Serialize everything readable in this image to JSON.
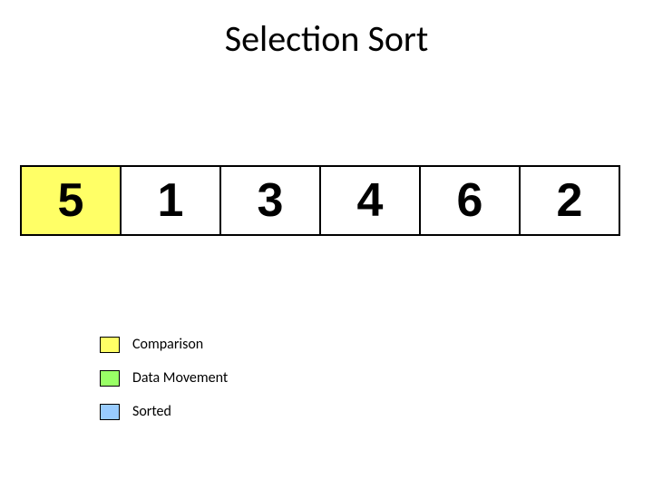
{
  "title": "Selection Sort",
  "colors": {
    "comparison": "#ffff66",
    "data_movement": "#99ff66",
    "sorted": "#99ccff",
    "default": "#ffffff"
  },
  "array": {
    "cells": [
      {
        "value": "5",
        "state": "comparison"
      },
      {
        "value": "1",
        "state": "default"
      },
      {
        "value": "3",
        "state": "default"
      },
      {
        "value": "4",
        "state": "default"
      },
      {
        "value": "6",
        "state": "default"
      },
      {
        "value": "2",
        "state": "default"
      }
    ]
  },
  "legend": [
    {
      "label": "Comparison",
      "color_key": "comparison"
    },
    {
      "label": "Data Movement",
      "color_key": "data_movement"
    },
    {
      "label": "Sorted",
      "color_key": "sorted"
    }
  ]
}
